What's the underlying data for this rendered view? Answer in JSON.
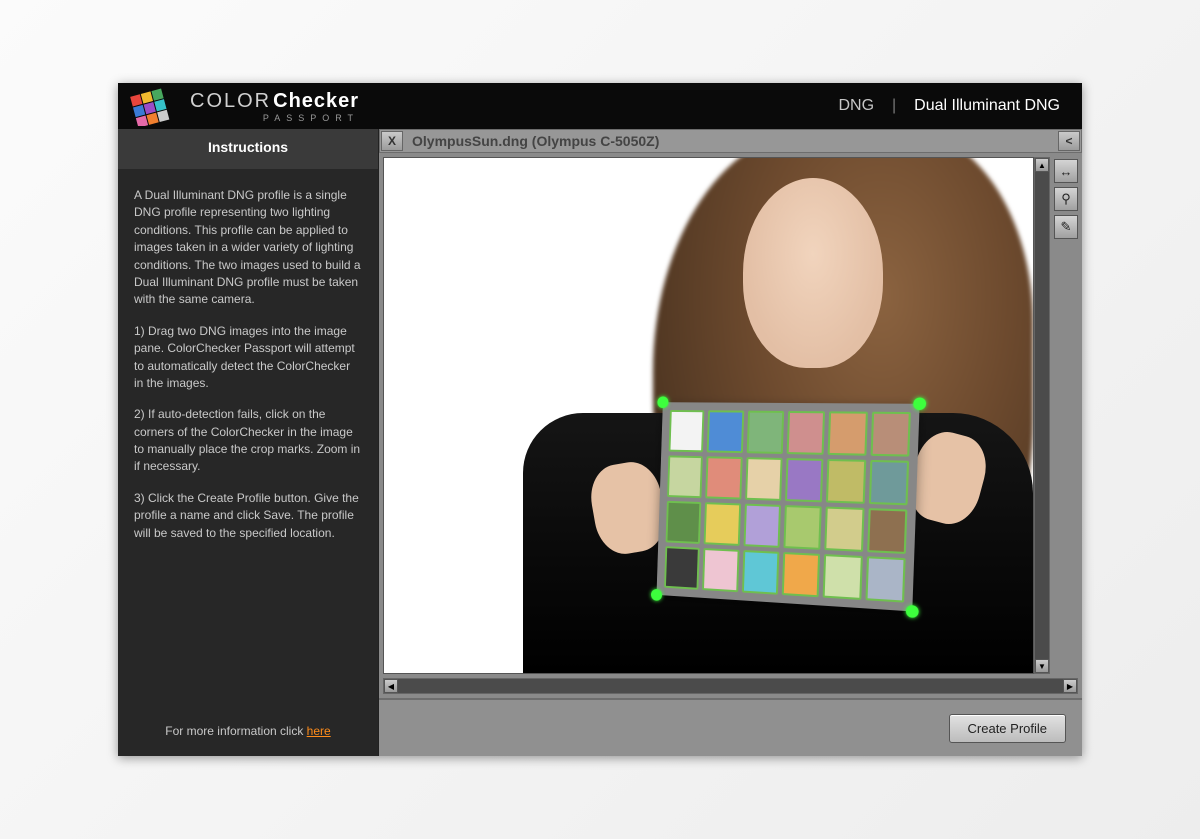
{
  "header": {
    "logo_prefix": "COLOR",
    "logo_suffix": "Checker",
    "logo_subtitle": "PASSPORT",
    "nav_dng": "DNG",
    "nav_sep": "|",
    "nav_dual": "Dual Illuminant DNG"
  },
  "sidebar": {
    "title": "Instructions",
    "intro": "A Dual Illuminant DNG profile is a single DNG profile representing two lighting conditions. This profile can be applied to images taken in a wider variety of lighting conditions. The two images used to build a Dual Illuminant DNG profile must be taken with the same camera.",
    "step1": "1) Drag two DNG images into the image pane. ColorChecker Passport will attempt to automatically detect the ColorChecker in the images.",
    "step2": "2) If auto-detection fails, click on the corners of the ColorChecker in the image to manually place the crop marks. Zoom in if necessary.",
    "step3": "3) Click the Create Profile button. Give the profile a name and click Save. The profile will be saved to the specified location.",
    "footer_text": "For more information click ",
    "footer_link": "here"
  },
  "image": {
    "close": "X",
    "title": "OlympusSun.dng (Olympus C-5050Z)",
    "collapse": "<"
  },
  "tools": {
    "move": "↔",
    "zoom": "⚲",
    "auto": "✎"
  },
  "actions": {
    "create": "Create Profile"
  },
  "swatches": [
    "#f3f3f3",
    "#4f8cd6",
    "#7fb57a",
    "#cf8f8e",
    "#d59c6d",
    "#b88e78",
    "#c6d6a0",
    "#e08c7a",
    "#e6d1a8",
    "#9978c4",
    "#c0bb66",
    "#6f9a9a",
    "#5f8f4a",
    "#e6cc5b",
    "#b1a0d8",
    "#a8c96e",
    "#d2cc8c",
    "#8e7050",
    "#3a3a3a",
    "#eec5d2",
    "#5fc7d6",
    "#f0a84a",
    "#cfe0aa",
    "#aab5c7"
  ]
}
